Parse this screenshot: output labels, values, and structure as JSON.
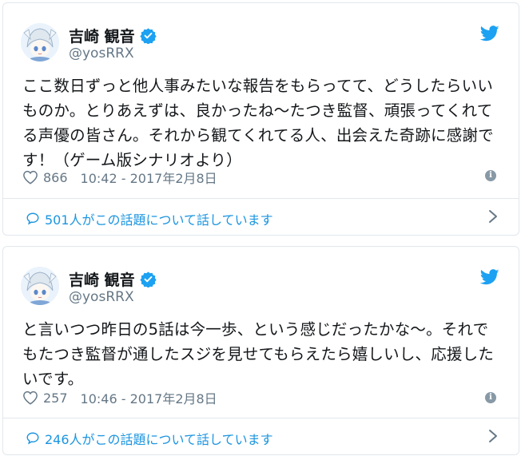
{
  "tweets": [
    {
      "author_name": "吉崎 観音",
      "handle": "@yosRRX",
      "text": "ここ数日ずっと他人事みたいな報告をもらってて、どうしたらいいものか。とりあえずは、良かったね～たつき監督、頑張ってくれてる声優の皆さん。それから観てくれてる人、出会えた奇跡に感謝です！（ゲーム版シナリオより）",
      "likes": "866",
      "timestamp": "10:42 - 2017年2月8日",
      "conversation": "501人がこの話題について話しています"
    },
    {
      "author_name": "吉崎 観音",
      "handle": "@yosRRX",
      "text": "と言いつつ昨日の5話は今一歩、という感じだったかな～。それでもたつき監督が通したスジを見せてもらえたら嬉しいし、応援したいです。",
      "likes": "257",
      "timestamp": "10:46 - 2017年2月8日",
      "conversation": "246人がこの話題について話しています"
    }
  ],
  "icons": {
    "brand": "twitter-bird-icon",
    "verified": "verified-badge-icon",
    "like": "heart-icon",
    "info": "info-icon",
    "conversation": "speech-bubble-icon",
    "chevron": "chevron-right-icon"
  },
  "colors": {
    "accent": "#1da1f2",
    "link": "#1b95e0",
    "muted": "#657786",
    "border": "#e1e8ed",
    "text": "#14171a"
  }
}
